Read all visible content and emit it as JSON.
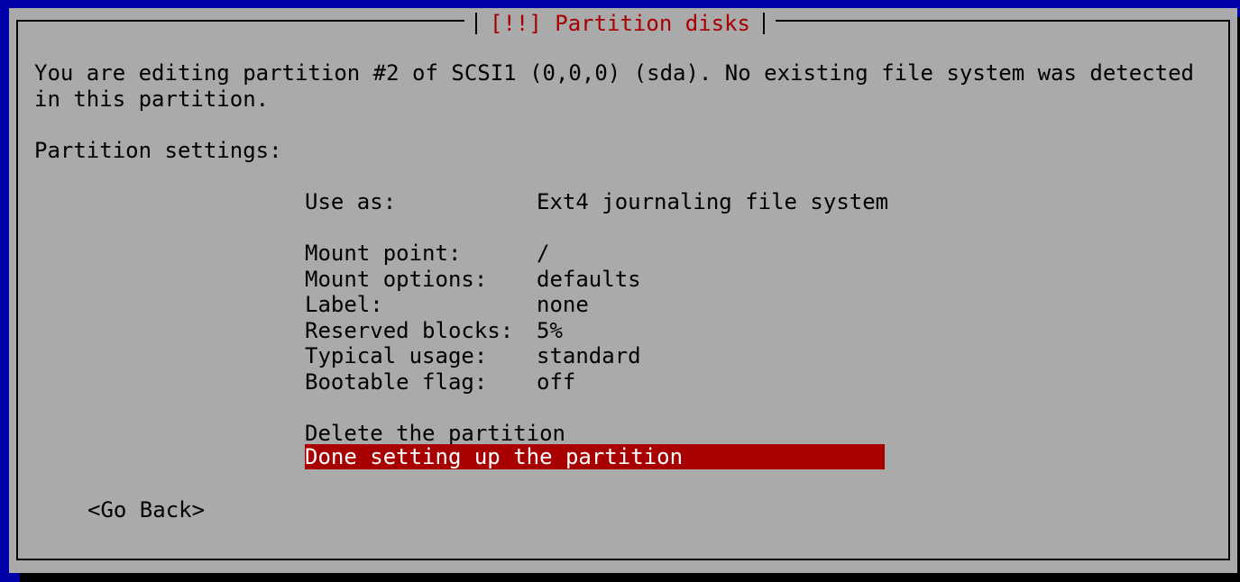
{
  "dialog": {
    "title": "[!!] Partition disks",
    "description_line1": "You are editing partition #2 of SCSI1 (0,0,0) (sda). No existing file system was detected",
    "description_line2": "in this partition.",
    "settings_heading": "Partition settings:"
  },
  "settings": {
    "use_as": {
      "label": "Use as:",
      "value": "Ext4 journaling file system"
    },
    "mount_point": {
      "label": "Mount point:",
      "value": "/"
    },
    "mount_options": {
      "label": "Mount options:",
      "value": "defaults"
    },
    "label": {
      "label": "Label:",
      "value": "none"
    },
    "reserved_blocks": {
      "label": "Reserved blocks:",
      "value": "5%"
    },
    "typical_usage": {
      "label": "Typical usage:",
      "value": "standard"
    },
    "bootable_flag": {
      "label": "Bootable flag:",
      "value": "off"
    }
  },
  "actions": {
    "delete": "Delete the partition",
    "done": "Done setting up the partition"
  },
  "buttons": {
    "go_back": "<Go Back>"
  },
  "colors": {
    "screen_background": "#0000a8",
    "dialog_background": "#aaaaaa",
    "title_color": "#a80000",
    "selection_background": "#a80000",
    "selection_text": "#ffffff"
  }
}
